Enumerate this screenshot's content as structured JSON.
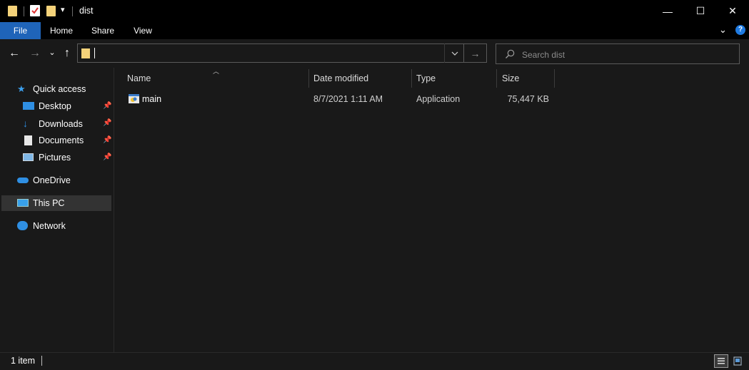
{
  "window": {
    "title": "dist",
    "minimize_glyph": "—",
    "maximize_glyph": "☐",
    "close_glyph": "✕"
  },
  "ribbon": {
    "tabs": [
      "File",
      "Home",
      "Share",
      "View"
    ],
    "help_glyph": "?",
    "expand_glyph": "⌄"
  },
  "nav": {
    "back_glyph": "←",
    "forward_glyph": "→",
    "recent_glyph": "⌄",
    "up_glyph": "↑",
    "address_value": "",
    "search_placeholder": "Search dist"
  },
  "sidebar": {
    "items": [
      {
        "label": "Quick access",
        "icon": "star-icon"
      },
      {
        "label": "Desktop",
        "icon": "desktop-icon",
        "pinned": true
      },
      {
        "label": "Downloads",
        "icon": "download-icon",
        "pinned": true
      },
      {
        "label": "Documents",
        "icon": "documents-icon",
        "pinned": true
      },
      {
        "label": "Pictures",
        "icon": "pictures-icon",
        "pinned": true
      },
      {
        "label": "OneDrive",
        "icon": "cloud-icon"
      },
      {
        "label": "This PC",
        "icon": "computer-icon",
        "selected": true
      },
      {
        "label": "Network",
        "icon": "network-icon"
      }
    ]
  },
  "columns": [
    "Name",
    "Date modified",
    "Type",
    "Size"
  ],
  "files": [
    {
      "name": "main",
      "date_modified": "8/7/2021 1:11 AM",
      "type": "Application",
      "size": "75,447 KB"
    }
  ],
  "status": {
    "item_count": "1 item"
  },
  "colors": {
    "background": "#191919",
    "titlebar": "#000000",
    "file_tab": "#1f64b9",
    "selected": "#333333",
    "folder": "#f4d27a"
  }
}
